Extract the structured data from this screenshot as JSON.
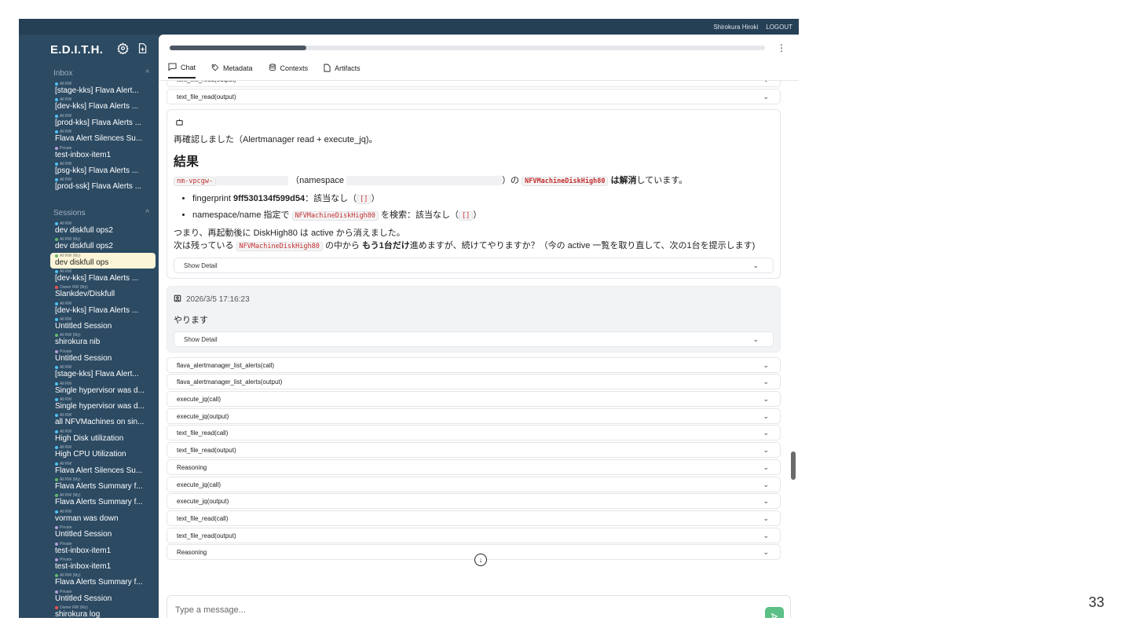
{
  "topbar": {
    "user": "Shirokura Hiroki",
    "logout": "LOGOUT"
  },
  "sidebar": {
    "brand": "E.D.I.T.H.",
    "inbox_title": "Inbox",
    "sessions_title": "Sessions",
    "inbox": [
      {
        "tag": "All RW",
        "label": "[stage-kks] Flava Alert...",
        "dot": "#4fc3f7"
      },
      {
        "tag": "All RW",
        "label": "[dev-kks] Flava Alerts ...",
        "dot": "#4fc3f7"
      },
      {
        "tag": "All RW",
        "label": "[prod-kks] Flava Alerts ...",
        "dot": "#4fc3f7"
      },
      {
        "tag": "All RW",
        "label": "Flava Alert Silences Su...",
        "dot": "#4fc3f7"
      },
      {
        "tag": "Private",
        "label": "test-inbox-item1",
        "dot": "#b39ddb"
      },
      {
        "tag": "All RW",
        "label": "[psg-kks] Flava Alerts ...",
        "dot": "#4fc3f7"
      },
      {
        "tag": "All RW",
        "label": "[prod-ssk] Flava Alerts ...",
        "dot": "#4fc3f7"
      }
    ],
    "sessions": [
      {
        "tag": "All RW",
        "label": "dev diskfull ops2",
        "dot": "#4fc3f7"
      },
      {
        "tag": "All RW (My)",
        "label": "dev diskfull ops2",
        "dot": "#66bb6a"
      },
      {
        "tag": "All RW (My)",
        "label": "dev diskfull ops",
        "dot": "#66bb6a",
        "active": true
      },
      {
        "tag": "All RW",
        "label": "[dev-kks] Flava Alerts ...",
        "dot": "#4fc3f7"
      },
      {
        "tag": "Owner RW (My)",
        "label": "Slankdev/Diskfull",
        "dot": "#ef5350"
      },
      {
        "tag": "All RW",
        "label": "[dev-kks] Flava Alerts ...",
        "dot": "#4fc3f7"
      },
      {
        "tag": "All RW",
        "label": "Untitled Session",
        "dot": "#4fc3f7"
      },
      {
        "tag": "All RW (My)",
        "label": "shirokura nib",
        "dot": "#66bb6a"
      },
      {
        "tag": "Private",
        "label": "Untitled Session",
        "dot": "#b39ddb"
      },
      {
        "tag": "All RW",
        "label": "[stage-kks] Flava Alert...",
        "dot": "#4fc3f7"
      },
      {
        "tag": "All RW",
        "label": "Single hypervisor was d...",
        "dot": "#4fc3f7"
      },
      {
        "tag": "All RW",
        "label": "Single hypervisor was d...",
        "dot": "#4fc3f7"
      },
      {
        "tag": "All RW",
        "label": "all NFVMachines on sin...",
        "dot": "#4fc3f7"
      },
      {
        "tag": "All RW",
        "label": "High Disk utilization",
        "dot": "#4fc3f7"
      },
      {
        "tag": "All RW",
        "label": "High CPU Utilization",
        "dot": "#4fc3f7"
      },
      {
        "tag": "All RW",
        "label": "Flava Alert Silences Su...",
        "dot": "#4fc3f7"
      },
      {
        "tag": "All RW (My)",
        "label": "Flava Alerts Summary f...",
        "dot": "#66bb6a"
      },
      {
        "tag": "All RW (My)",
        "label": "Flava Alerts Summary f...",
        "dot": "#66bb6a"
      },
      {
        "tag": "All RW",
        "label": "vorman was down",
        "dot": "#4fc3f7"
      },
      {
        "tag": "Private",
        "label": "Untitled Session",
        "dot": "#b39ddb"
      },
      {
        "tag": "Private",
        "label": "test-inbox-item1",
        "dot": "#b39ddb"
      },
      {
        "tag": "Private",
        "label": "test-inbox-item1",
        "dot": "#b39ddb"
      },
      {
        "tag": "All RW (My)",
        "label": "Flava Alerts Summary f...",
        "dot": "#66bb6a"
      },
      {
        "tag": "Private",
        "label": "Untitled Session",
        "dot": "#b39ddb"
      },
      {
        "tag": "Owner RW (My)",
        "label": "shirokura log",
        "dot": "#ef5350"
      }
    ]
  },
  "main": {
    "progress": 0.23,
    "tabs": [
      {
        "label": "Chat",
        "icon": "chat-icon",
        "active": true
      },
      {
        "label": "Metadata",
        "icon": "tag-icon"
      },
      {
        "label": "Contexts",
        "icon": "database-icon"
      },
      {
        "label": "Artifacts",
        "icon": "file-icon"
      }
    ],
    "top_accordions": [
      "text_file_read(output)",
      "text_file_read(output)"
    ],
    "assistant": {
      "intro": "再確認しました（Alertmanager read + execute_jq)。",
      "heading": "結果",
      "line1": {
        "code_a": "nm-vpcgw-",
        "t1": "（namespace",
        "t2": "）の",
        "code_b": "NFVMachineDiskHigh80",
        "bold": "は解消",
        "t3": "しています。"
      },
      "bullets": {
        "b1_pre": "fingerprint",
        "b1_bold": "9ff530134f599d54",
        "b1_post": "：該当なし（",
        "b1_code": "[]",
        "b1_end": "）",
        "b2_pre": "namespace/name 指定で",
        "b2_code": "NFVMachineDiskHigh80",
        "b2_post": "を検索：該当なし（",
        "b2_code2": "[]",
        "b2_end": "）"
      },
      "p2": "つまり、再起動後に DiskHigh80 は active から消えました。",
      "p3_pre": "次は残っている",
      "p3_code": "NFVMachineDiskHigh80",
      "p3_mid": "の中から",
      "p3_bold": "もう1台だけ",
      "p3_post": "進めますが、続けてやりますか？（今の active 一覧を取り直して、次の1台を提示します)",
      "show_detail": "Show Detail"
    },
    "user_msg": {
      "timestamp": "2026/3/5 17:16:23",
      "text": "やります",
      "show_detail": "Show Detail"
    },
    "tool_accordions": [
      "flava_alertmanager_list_alerts(call)",
      "flava_alertmanager_list_alerts(output)",
      "execute_jq(call)",
      "execute_jq(output)",
      "text_file_read(call)",
      "text_file_read(output)",
      "Reasoning",
      "execute_jq(call)",
      "execute_jq(output)",
      "text_file_read(call)",
      "text_file_read(output)",
      "Reasoning"
    ],
    "composer_placeholder": "Type a message..."
  },
  "page_number": "33"
}
